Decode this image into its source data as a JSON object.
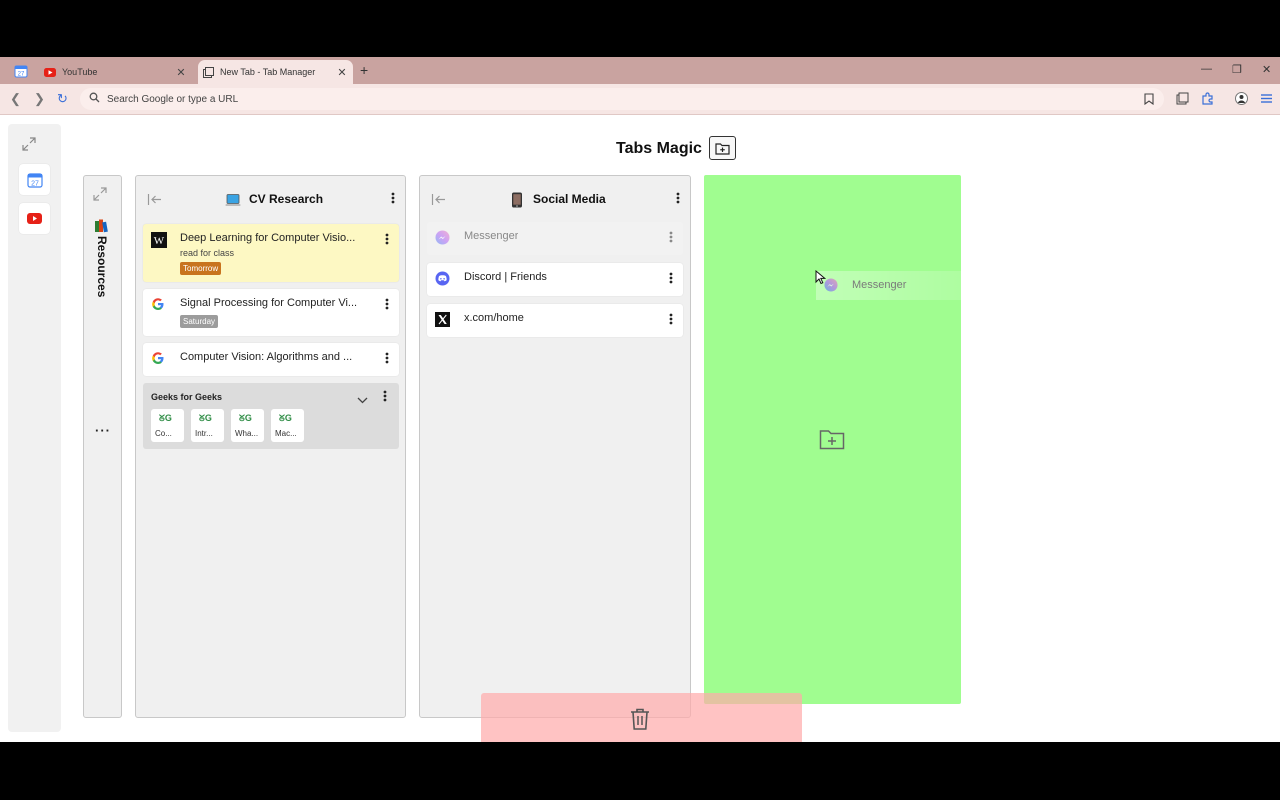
{
  "browser": {
    "tabs": [
      {
        "title": "YouTube",
        "icon": "youtube-icon",
        "active": false
      },
      {
        "title": "New Tab - Tab Manager",
        "icon": "tab-manager-icon",
        "active": true
      }
    ],
    "new_tab_label": "+",
    "address_placeholder": "Search Google or type a URL"
  },
  "app": {
    "title": "Tabs Magic"
  },
  "columns": {
    "resources": {
      "name": "Resources",
      "emoji": "books-icon"
    },
    "cv": {
      "name": "CV Research",
      "emoji": "laptop-icon",
      "cards": [
        {
          "title": "Deep Learning for Computer Visio...",
          "note": "read for class",
          "badge": "Tomorrow",
          "icon": "wikipedia-icon"
        },
        {
          "title": "Signal Processing for Computer Vi...",
          "badge": "Saturday",
          "icon": "google-icon"
        },
        {
          "title": "Computer Vision: Algorithms and ...",
          "icon": "google-icon"
        }
      ],
      "group": {
        "name": "Geeks for Geeks",
        "items": [
          {
            "label": "Co...",
            "icon": "gfg-icon"
          },
          {
            "label": "Intr...",
            "icon": "gfg-icon"
          },
          {
            "label": "Wha...",
            "icon": "gfg-icon"
          },
          {
            "label": "Mac...",
            "icon": "gfg-icon"
          }
        ]
      }
    },
    "social": {
      "name": "Social Media",
      "emoji": "mobile-phone-icon",
      "cards": [
        {
          "title": "Messenger",
          "icon": "messenger-icon",
          "dragging": true
        },
        {
          "title": "Discord | Friends",
          "icon": "discord-icon"
        },
        {
          "title": "x.com/home",
          "icon": "x-icon"
        }
      ]
    }
  },
  "drag": {
    "ghost_title": "Messenger"
  },
  "colors": {
    "new_column_dropzone": "#a0fd90",
    "trash_dropzone": "#ffaaaa",
    "highlight_card": "#fdf8c3",
    "badge_tomorrow": "#c8741e",
    "badge_saturday": "#9c9c9c",
    "tab_strip": "#c9a3a0"
  }
}
